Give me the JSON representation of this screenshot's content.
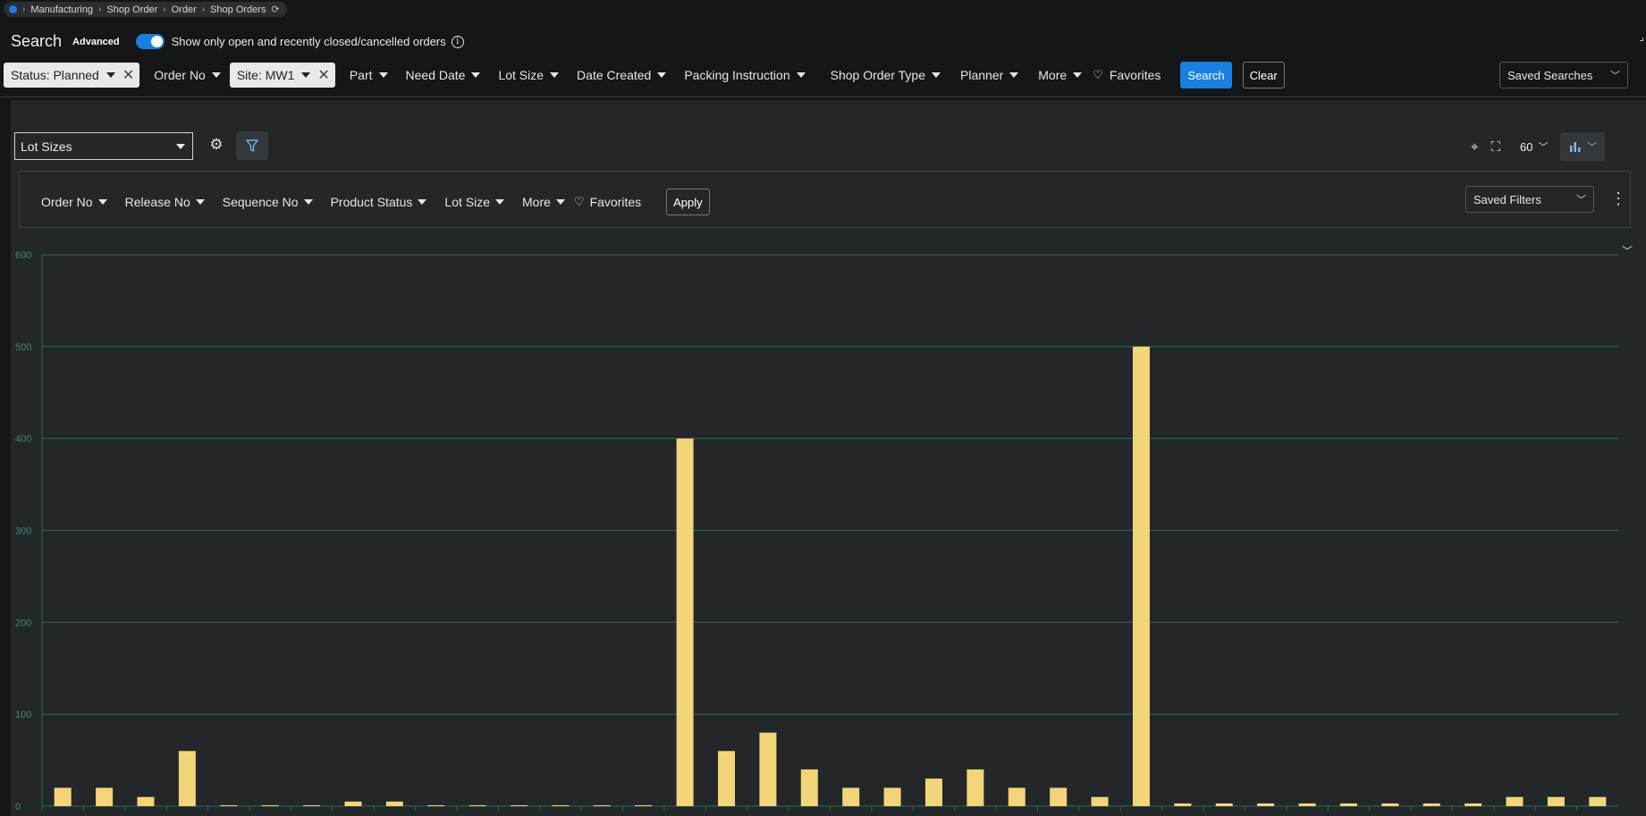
{
  "breadcrumb": {
    "items": [
      "Manufacturing",
      "Shop Order",
      "Order",
      "Shop Orders"
    ]
  },
  "search": {
    "title": "Search",
    "advanced_label": "Advanced",
    "toggle_label": "Show only open and recently closed/cancelled orders",
    "chips": [
      {
        "label": "Status: Planned"
      },
      {
        "label": "Order No"
      },
      {
        "label": "Site: MW1"
      }
    ],
    "filters": [
      "Part",
      "Need Date",
      "Lot Size",
      "Date Created",
      "Packing Instruction",
      "Shop Order Type",
      "Planner",
      "More"
    ],
    "favorites_label": "Favorites",
    "search_button": "Search",
    "clear_button": "Clear",
    "saved_searches": "Saved Searches"
  },
  "chart_panel": {
    "chart_select": "Lot Sizes",
    "page_size": "60",
    "filters": [
      "Order No",
      "Release No",
      "Sequence No",
      "Product Status",
      "Lot Size",
      "More"
    ],
    "favorites_label": "Favorites",
    "apply_button": "Apply",
    "saved_filters": "Saved Filters"
  },
  "colors": {
    "accent": "#1a7fe0",
    "bar": "#f2d479",
    "grid": "#2f6b55",
    "axis_label": "#3f8a6a",
    "panel_bg": "#232729"
  },
  "chart_data": {
    "type": "bar",
    "title": "",
    "xlabel": "",
    "ylabel": "",
    "ylim": [
      0,
      600
    ],
    "yticks": [
      0,
      100,
      200,
      300,
      400,
      500,
      600
    ],
    "grid": true,
    "series": [
      {
        "values": [
          20,
          20,
          10,
          60,
          1,
          1,
          1,
          5,
          5,
          1,
          1,
          1,
          1,
          1,
          1,
          400,
          60,
          80,
          40,
          20,
          20,
          30,
          40,
          20,
          20,
          10,
          500,
          3,
          3,
          3,
          3,
          3,
          3,
          3,
          3,
          10,
          10,
          10
        ]
      }
    ]
  }
}
